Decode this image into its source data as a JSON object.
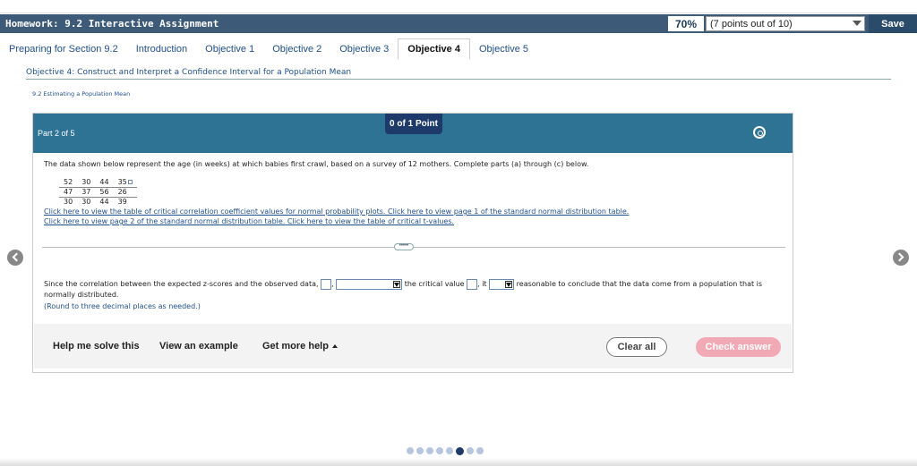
{
  "homework": {
    "title": "Homework: 9.2 Interactive Assignment",
    "score": "70%",
    "points_selected": "(7 points out of 10)",
    "save_label": "Save"
  },
  "tabs": [
    {
      "label": "Preparing for Section 9.2"
    },
    {
      "label": "Introduction"
    },
    {
      "label": "Objective 1"
    },
    {
      "label": "Objective 2"
    },
    {
      "label": "Objective 3"
    },
    {
      "label": "Objective 4",
      "active": true
    },
    {
      "label": "Objective 5"
    }
  ],
  "objective_title": "Objective 4: Construct and Interpret a Confidence Interval for a Population Mean",
  "section_subtitle": "9.2 Estimating a Population Mean",
  "question": {
    "part": "Part 2 of 5",
    "points": "0 of 1 Point",
    "intro": "The data shown below represent the age (in weeks) at which babies first crawl, based on a survey of 12 mothers. Complete parts (a) through (c) below.",
    "data_rows": [
      [
        "52",
        "30",
        "44",
        "35"
      ],
      [
        "47",
        "37",
        "56",
        "26"
      ],
      [
        "30",
        "30",
        "44",
        "39"
      ]
    ],
    "link1a": "Click here to view the table of critical correlation coefficient values for normal probability plots.",
    "link1b": "Click here to view page 1 of the standard normal distribution table.",
    "link2a": "Click here to view page 2 of the standard normal distribution table.",
    "link2b": "Click here to view the table of critical t-values.",
    "more_dots": "•••••",
    "answer_part1": "Since the correlation between the expected z-scores and the observed data,",
    "answer_part2": "the critical value",
    "answer_part3": ", it",
    "answer_part4": "reasonable to conclude that the data come from a population that is",
    "answer_part5": "normally distributed.",
    "round_note": "(Round to three decimal places as needed.)"
  },
  "footer": {
    "help_solve": "Help me solve this",
    "view_example": "View an example",
    "get_more_help": "Get more help",
    "clear_all": "Clear all",
    "check_answer": "Check answer"
  },
  "pager": {
    "total": 8,
    "current": 5
  }
}
